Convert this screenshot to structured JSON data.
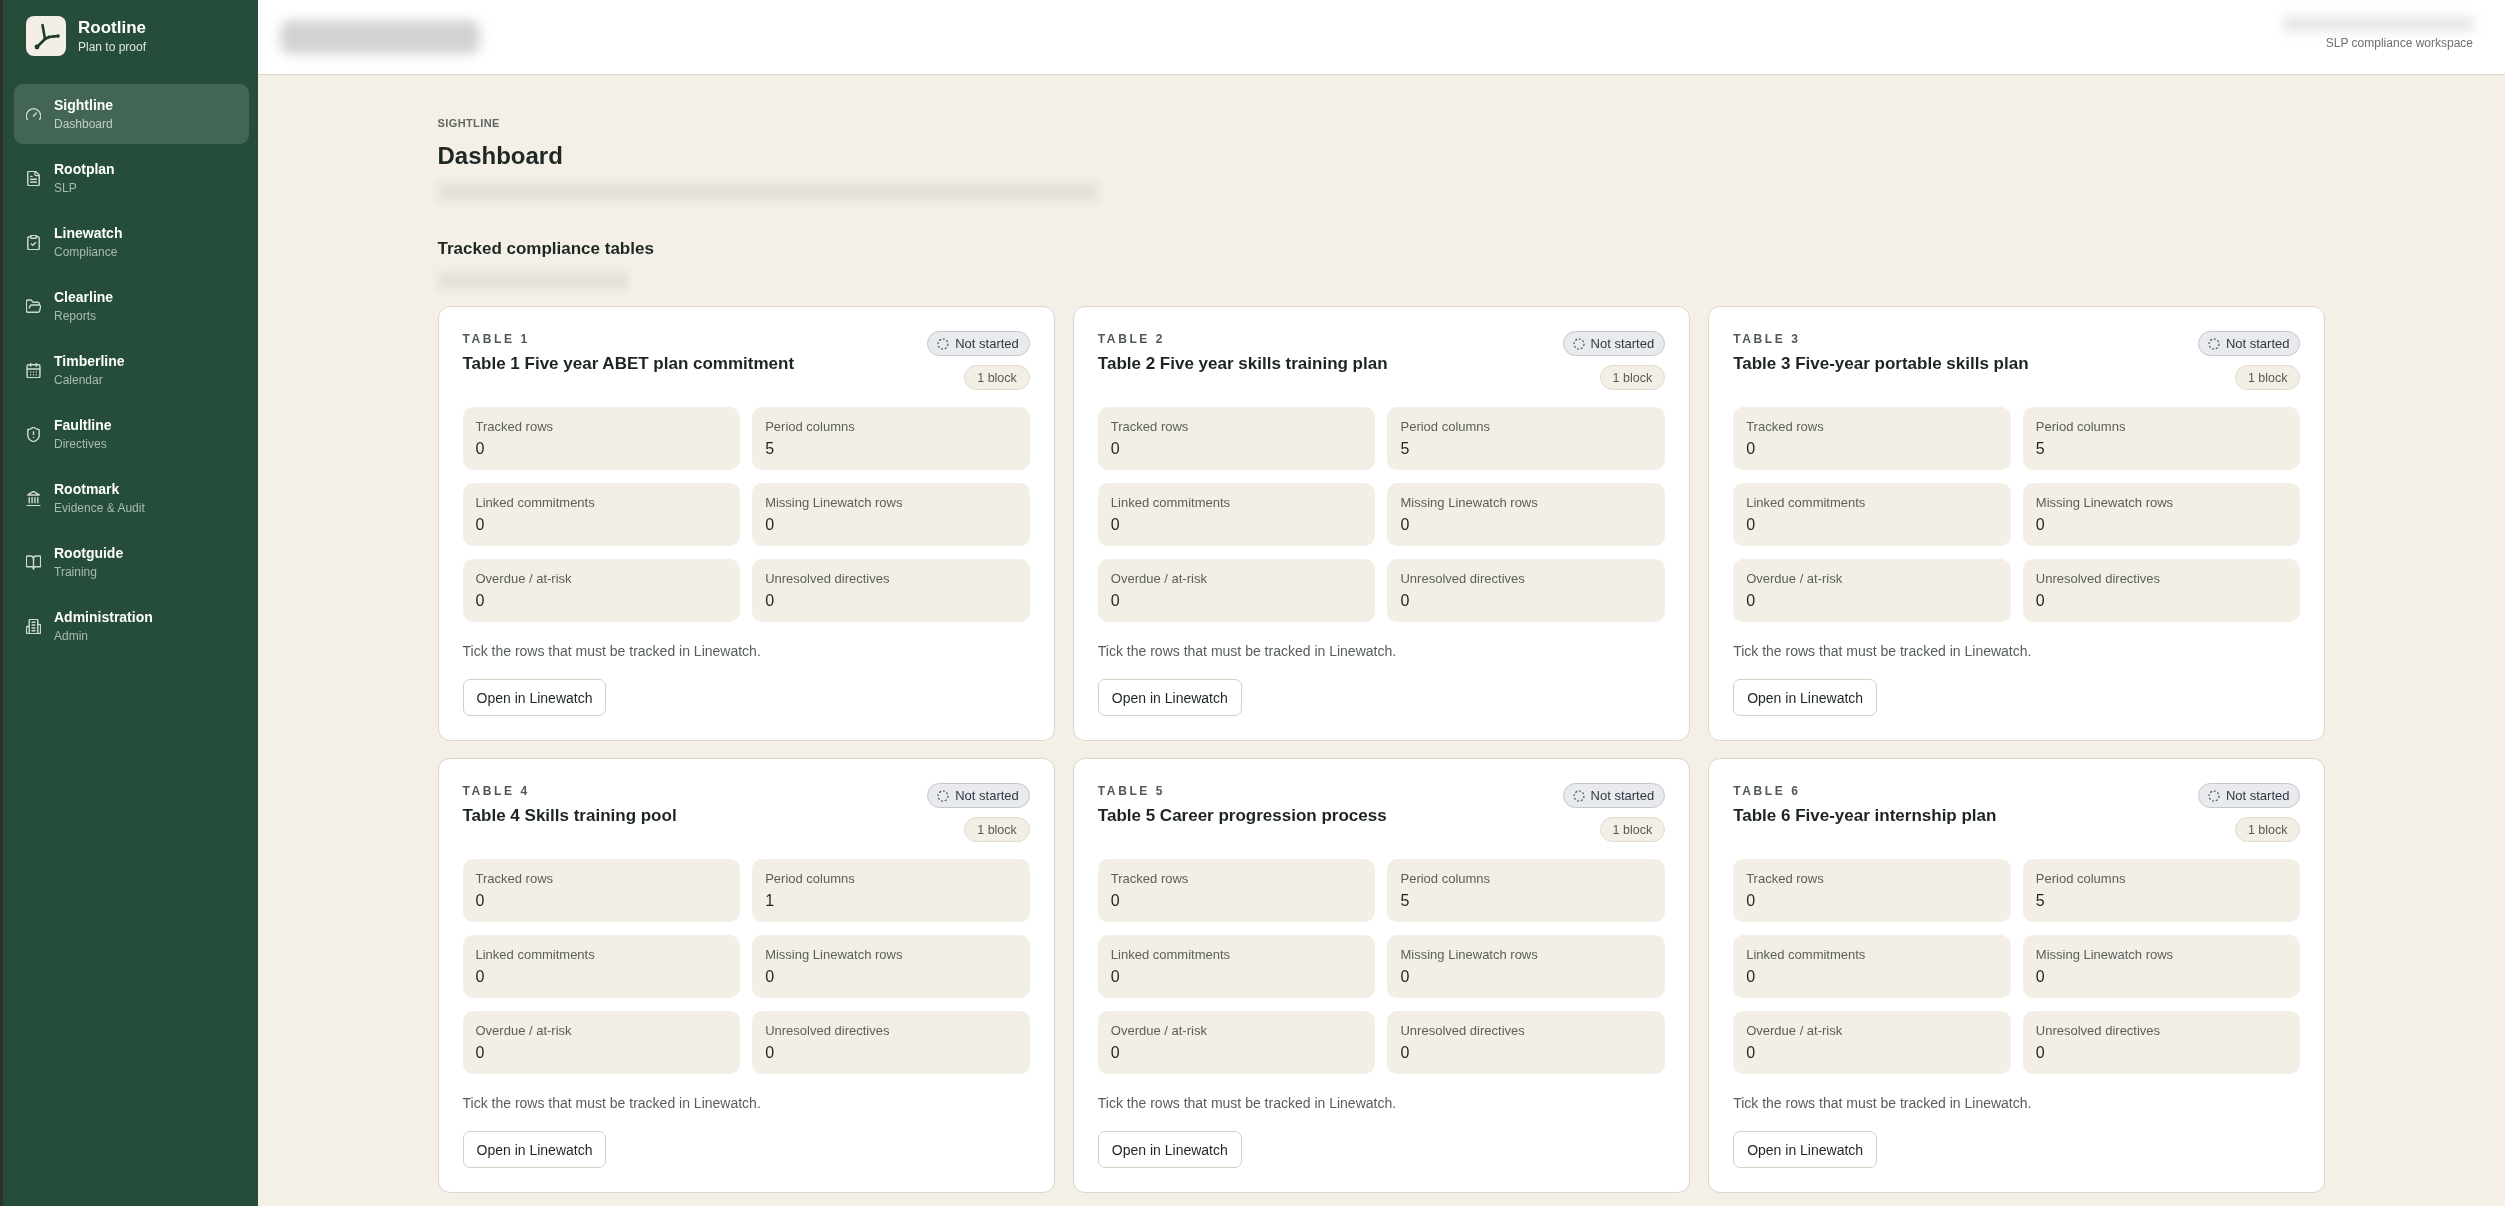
{
  "sidebar": {
    "brand": {
      "name": "Rootline",
      "tagline": "Plan to proof"
    },
    "items": [
      {
        "title": "Sightline",
        "subtitle": "Dashboard",
        "selected": true
      },
      {
        "title": "Rootplan",
        "subtitle": "SLP",
        "selected": false
      },
      {
        "title": "Linewatch",
        "subtitle": "Compliance",
        "selected": false
      },
      {
        "title": "Clearline",
        "subtitle": "Reports",
        "selected": false
      },
      {
        "title": "Timberline",
        "subtitle": "Calendar",
        "selected": false
      },
      {
        "title": "Faultline",
        "subtitle": "Directives",
        "selected": false
      },
      {
        "title": "Rootmark",
        "subtitle": "Evidence & Audit",
        "selected": false
      },
      {
        "title": "Rootguide",
        "subtitle": "Training",
        "selected": false
      },
      {
        "title": "Administration",
        "subtitle": "Admin",
        "selected": false
      }
    ]
  },
  "header": {
    "workspace": "SLP compliance workspace"
  },
  "page": {
    "eyebrow": "SIGHTLINE",
    "title": "Dashboard"
  },
  "tracked_tables": {
    "title": "Tracked compliance tables",
    "cards": [
      {
        "label": "TABLE 1",
        "title": "Table 1 Five year ABET plan commitment",
        "status": "Not started",
        "blocks": "1 block",
        "metrics": [
          {
            "label": "Tracked rows",
            "value": "0"
          },
          {
            "label": "Period columns",
            "value": "5"
          },
          {
            "label": "Linked commitments",
            "value": "0"
          },
          {
            "label": "Missing Linewatch rows",
            "value": "0"
          },
          {
            "label": "Overdue / at-risk",
            "value": "0"
          },
          {
            "label": "Unresolved directives",
            "value": "0"
          }
        ],
        "note": "Tick the rows that must be tracked in Linewatch.",
        "action": "Open in Linewatch"
      },
      {
        "label": "TABLE 2",
        "title": "Table 2 Five year skills training plan",
        "status": "Not started",
        "blocks": "1 block",
        "metrics": [
          {
            "label": "Tracked rows",
            "value": "0"
          },
          {
            "label": "Period columns",
            "value": "5"
          },
          {
            "label": "Linked commitments",
            "value": "0"
          },
          {
            "label": "Missing Linewatch rows",
            "value": "0"
          },
          {
            "label": "Overdue / at-risk",
            "value": "0"
          },
          {
            "label": "Unresolved directives",
            "value": "0"
          }
        ],
        "note": "Tick the rows that must be tracked in Linewatch.",
        "action": "Open in Linewatch"
      },
      {
        "label": "TABLE 3",
        "title": "Table 3 Five-year portable skills plan",
        "status": "Not started",
        "blocks": "1 block",
        "metrics": [
          {
            "label": "Tracked rows",
            "value": "0"
          },
          {
            "label": "Period columns",
            "value": "5"
          },
          {
            "label": "Linked commitments",
            "value": "0"
          },
          {
            "label": "Missing Linewatch rows",
            "value": "0"
          },
          {
            "label": "Overdue / at-risk",
            "value": "0"
          },
          {
            "label": "Unresolved directives",
            "value": "0"
          }
        ],
        "note": "Tick the rows that must be tracked in Linewatch.",
        "action": "Open in Linewatch"
      },
      {
        "label": "TABLE 4",
        "title": "Table 4 Skills training pool",
        "status": "Not started",
        "blocks": "1 block",
        "metrics": [
          {
            "label": "Tracked rows",
            "value": "0"
          },
          {
            "label": "Period columns",
            "value": "1"
          },
          {
            "label": "Linked commitments",
            "value": "0"
          },
          {
            "label": "Missing Linewatch rows",
            "value": "0"
          },
          {
            "label": "Overdue / at-risk",
            "value": "0"
          },
          {
            "label": "Unresolved directives",
            "value": "0"
          }
        ],
        "note": "Tick the rows that must be tracked in Linewatch.",
        "action": "Open in Linewatch"
      },
      {
        "label": "TABLE 5",
        "title": "Table 5 Career progression process",
        "status": "Not started",
        "blocks": "1 block",
        "metrics": [
          {
            "label": "Tracked rows",
            "value": "0"
          },
          {
            "label": "Period columns",
            "value": "5"
          },
          {
            "label": "Linked commitments",
            "value": "0"
          },
          {
            "label": "Missing Linewatch rows",
            "value": "0"
          },
          {
            "label": "Overdue / at-risk",
            "value": "0"
          },
          {
            "label": "Unresolved directives",
            "value": "0"
          }
        ],
        "note": "Tick the rows that must be tracked in Linewatch.",
        "action": "Open in Linewatch"
      },
      {
        "label": "TABLE 6",
        "title": "Table 6 Five-year internship plan",
        "status": "Not started",
        "blocks": "1 block",
        "metrics": [
          {
            "label": "Tracked rows",
            "value": "0"
          },
          {
            "label": "Period columns",
            "value": "5"
          },
          {
            "label": "Linked commitments",
            "value": "0"
          },
          {
            "label": "Missing Linewatch rows",
            "value": "0"
          },
          {
            "label": "Overdue / at-risk",
            "value": "0"
          },
          {
            "label": "Unresolved directives",
            "value": "0"
          }
        ],
        "note": "Tick the rows that must be tracked in Linewatch.",
        "action": "Open in Linewatch"
      }
    ]
  }
}
